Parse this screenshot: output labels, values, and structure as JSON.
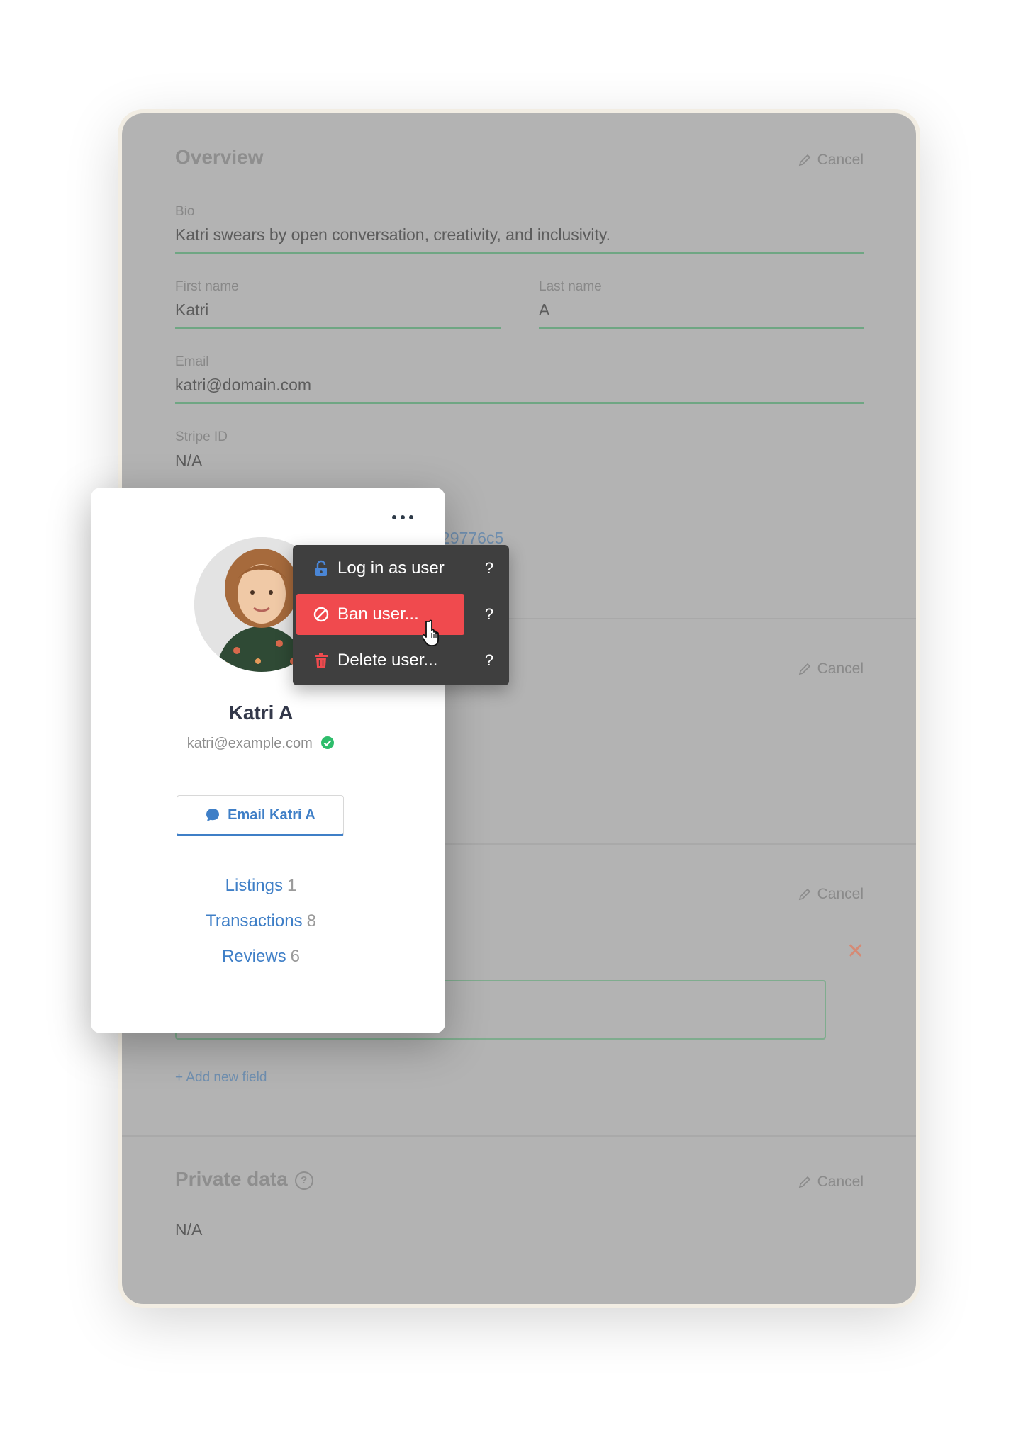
{
  "overview": {
    "title": "Overview",
    "cancel_label": "Cancel",
    "bio": {
      "label": "Bio",
      "value": "Katri swears by open conversation, creativity, and inclusivity."
    },
    "first_name": {
      "label": "First name",
      "value": "Katri"
    },
    "last_name": {
      "label": "Last name",
      "value": "A"
    },
    "email": {
      "label": "Email",
      "value": "katri@domain.com"
    },
    "stripe_id": {
      "label": "Stripe ID",
      "value": "N/A"
    },
    "id_fragment": "29776c5"
  },
  "section_two": {
    "cancel_label": "Cancel"
  },
  "section_three": {
    "cancel_label": "Cancel",
    "add_field_label": "+ Add new field"
  },
  "private_data": {
    "title": "Private data",
    "help_glyph": "?",
    "cancel_label": "Cancel",
    "value": "N/A"
  },
  "user_card": {
    "name": "Katri A",
    "email": "katri@example.com",
    "email_verified": true,
    "email_button_label": "Email Katri A",
    "stats": [
      {
        "label": "Listings",
        "count": "1"
      },
      {
        "label": "Transactions",
        "count": "8"
      },
      {
        "label": "Reviews",
        "count": "6"
      }
    ]
  },
  "menu": {
    "items": [
      {
        "label": "Log in as user",
        "icon": "lock-icon",
        "help": "?"
      },
      {
        "label": "Ban user...",
        "icon": "ban-icon",
        "help": "?",
        "active": true
      },
      {
        "label": "Delete user...",
        "icon": "trash-icon",
        "help": "?"
      }
    ]
  },
  "colors": {
    "accent_blue": "#3f7fc7",
    "danger_red": "#f04a4e",
    "field_underline": "#6fa683",
    "menu_bg": "#3f3f3f",
    "overlay_gray": "#b3b3b3"
  }
}
